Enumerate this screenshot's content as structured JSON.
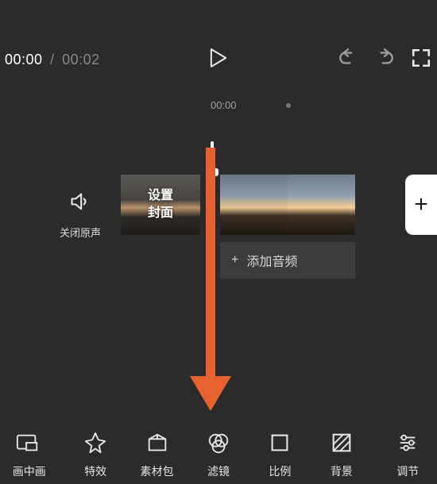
{
  "playback": {
    "current": "00:00",
    "separator": "/",
    "total": "00:02"
  },
  "timeline": {
    "head_time": "00:00",
    "mute_label": "关闭原声",
    "cover_thumb_text": "设置\n封面",
    "add_audio_label": "添加音频",
    "add_audio_prefix": "+",
    "add_clip_label": "+"
  },
  "tools": [
    {
      "id": "pip",
      "label": "画中画"
    },
    {
      "id": "effects",
      "label": "特效"
    },
    {
      "id": "stickers",
      "label": "素材包"
    },
    {
      "id": "filter",
      "label": "滤镜"
    },
    {
      "id": "ratio",
      "label": "比例"
    },
    {
      "id": "bg",
      "label": "背景"
    },
    {
      "id": "adjust",
      "label": "调节"
    }
  ]
}
